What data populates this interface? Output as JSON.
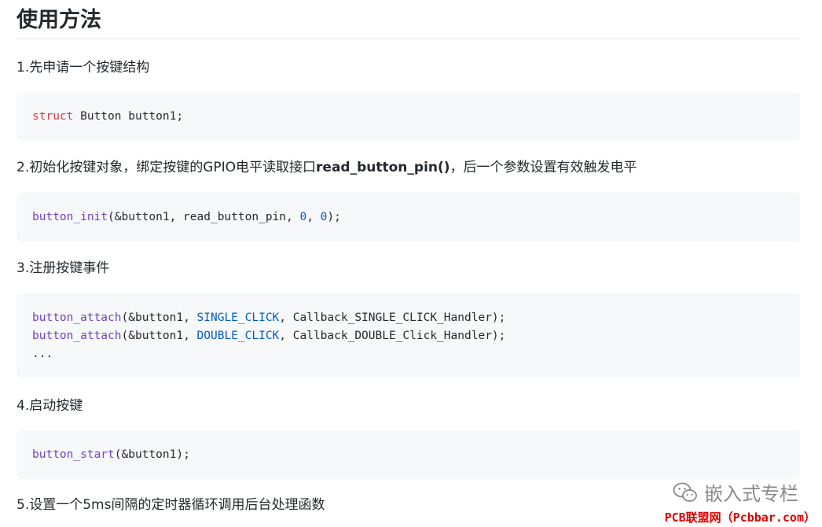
{
  "heading": "使用方法",
  "steps": [
    {
      "label": "1.先申请一个按键结构"
    },
    {
      "label_prefix": "2.初始化按键对象，绑定按键的GPIO电平读取接口",
      "label_bold": "read_button_pin()",
      "label_suffix": "，后一个参数设置有效触发电平"
    },
    {
      "label": "3.注册按键事件"
    },
    {
      "label": "4.启动按键"
    },
    {
      "label": "5.设置一个5ms间隔的定时器循环调用后台处理函数"
    }
  ],
  "code": {
    "block1": {
      "kw": "struct",
      "rest": " Button button1;"
    },
    "block2": {
      "fn": "button_init",
      "a": "(&button1, read_button_pin, ",
      "n1": "0",
      "b": ", ",
      "n2": "0",
      "c": ");"
    },
    "block3": {
      "line1": {
        "fn": "button_attach",
        "a": "(&button1, ",
        "const": "SINGLE_CLICK",
        "b": ", Callback_SINGLE_CLICK_Handler);"
      },
      "line2": {
        "fn": "button_attach",
        "a": "(&button1, ",
        "const": "DOUBLE_CLICK",
        "b": ", Callback_DOUBLE_Click_Handler);"
      },
      "line3": "..."
    },
    "block4": {
      "fn": "button_start",
      "a": "(&button1);"
    }
  },
  "watermark": {
    "text": "嵌入式专栏",
    "icon": "wechat-icon"
  },
  "footer_mark": "PCB联盟网（Pcbbar.com）"
}
